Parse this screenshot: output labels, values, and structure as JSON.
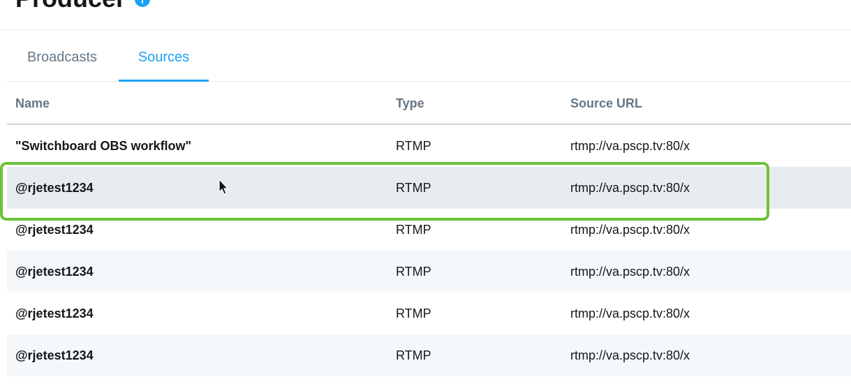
{
  "header": {
    "title": "Producer",
    "info_icon": "info-icon"
  },
  "tabs": [
    {
      "label": "Broadcasts",
      "active": false
    },
    {
      "label": "Sources",
      "active": true
    }
  ],
  "colors": {
    "accent": "#1da1f2",
    "highlight_outline": "#6cc23a"
  },
  "table": {
    "columns": [
      "Name",
      "Type",
      "Source URL"
    ],
    "rows": [
      {
        "name": "\"Switchboard OBS workflow\"",
        "type": "RTMP",
        "url": "rtmp://va.pscp.tv:80/x"
      },
      {
        "name": "@rjetest1234",
        "type": "RTMP",
        "url": "rtmp://va.pscp.tv:80/x"
      },
      {
        "name": "@rjetest1234",
        "type": "RTMP",
        "url": "rtmp://va.pscp.tv:80/x"
      },
      {
        "name": "@rjetest1234",
        "type": "RTMP",
        "url": "rtmp://va.pscp.tv:80/x"
      },
      {
        "name": "@rjetest1234",
        "type": "RTMP",
        "url": "rtmp://va.pscp.tv:80/x"
      },
      {
        "name": "@rjetest1234",
        "type": "RTMP",
        "url": "rtmp://va.pscp.tv:80/x"
      }
    ]
  }
}
